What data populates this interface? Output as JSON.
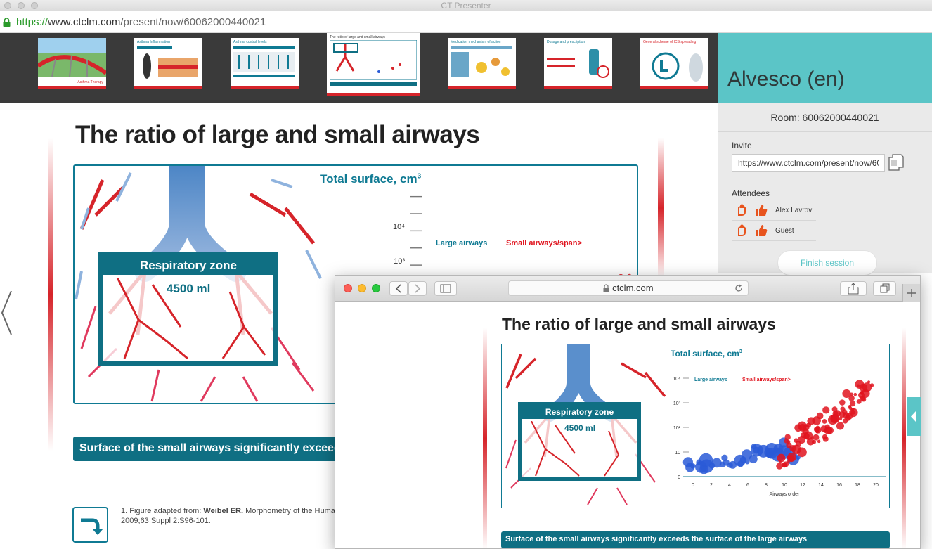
{
  "window": {
    "title": "CT Presenter"
  },
  "browser": {
    "url_https": "https://",
    "url_domain": "www.ctclm.com",
    "url_path": "/present/now/60062000440021"
  },
  "thumbnails": [
    {
      "title": "",
      "footer": "Asthma Therapy"
    },
    {
      "title": "Asthma Inflammation"
    },
    {
      "title": "Asthma control levels"
    },
    {
      "title": "The ratio of large and small airways",
      "active": true
    },
    {
      "title": "Medication mechanism of action"
    },
    {
      "title": "Dosage and prescription"
    },
    {
      "title": "General scheme of ICS spreading"
    }
  ],
  "panel": {
    "presentation_name": "Alvesco (en)",
    "room_label": "Room: 60062000440021",
    "invite_label": "Invite",
    "invite_value": "https://www.ctclm.com/present/now/60062000440021",
    "attendees_label": "Attendees",
    "attendees": [
      {
        "name": "Alex Lavrov"
      },
      {
        "name": "Guest"
      }
    ],
    "finish_label": "Finish session"
  },
  "slide": {
    "title": "The ratio of large and small airways",
    "chart_title": "Total surface, cm",
    "chart_title_sup": "3",
    "respiratory_zone": "Respiratory zone",
    "respiratory_volume": "4500 ml",
    "banner": "Surface of the small airways significantly exceeds the surface of the large airways",
    "footnote_prefix": "1. Figure adapted from: ",
    "footnote_author": "Weibel ER.",
    "footnote_text": " Morphometry of the Huma",
    "footnote_line2": "2009;63 Suppl 2:S96-101."
  },
  "safari": {
    "address": "ctclm.com"
  },
  "colors": {
    "teal": "#0f7a93",
    "accent": "#5bc5c7",
    "red": "#d6242a",
    "blue": "#2a5bd7"
  },
  "chart_data": {
    "type": "scatter",
    "title": "Total surface, cm3",
    "xlabel": "Airways order",
    "ylabel": "",
    "xlim": [
      0,
      20
    ],
    "x_ticks": [
      "0",
      "2",
      "4",
      "6",
      "8",
      "10",
      "12",
      "14",
      "16",
      "18",
      "20"
    ],
    "y_ticks": [
      "0",
      "10",
      "10²",
      "10³",
      "10⁴"
    ],
    "series": [
      {
        "name": "Large airways",
        "color": "#2a5bd7",
        "points": [
          [
            0,
            0.4
          ],
          [
            1,
            0.5
          ],
          [
            2,
            0.45
          ],
          [
            3,
            0.6
          ],
          [
            4,
            0.55
          ],
          [
            5,
            0.7
          ],
          [
            6,
            0.8
          ],
          [
            7,
            1.1
          ],
          [
            8,
            0.9
          ],
          [
            9,
            1.0
          ],
          [
            10,
            1.2
          ],
          [
            11,
            0.9
          ]
        ]
      },
      {
        "name": "Small airways/span>",
        "color": "#e0141e",
        "points": [
          [
            10,
            1.0
          ],
          [
            11,
            1.3
          ],
          [
            12,
            1.5
          ],
          [
            13,
            1.8
          ],
          [
            14,
            2.0
          ],
          [
            15,
            2.2
          ],
          [
            16,
            2.5
          ],
          [
            17,
            2.8
          ],
          [
            18,
            3.2
          ],
          [
            19,
            3.6
          ]
        ]
      }
    ]
  }
}
